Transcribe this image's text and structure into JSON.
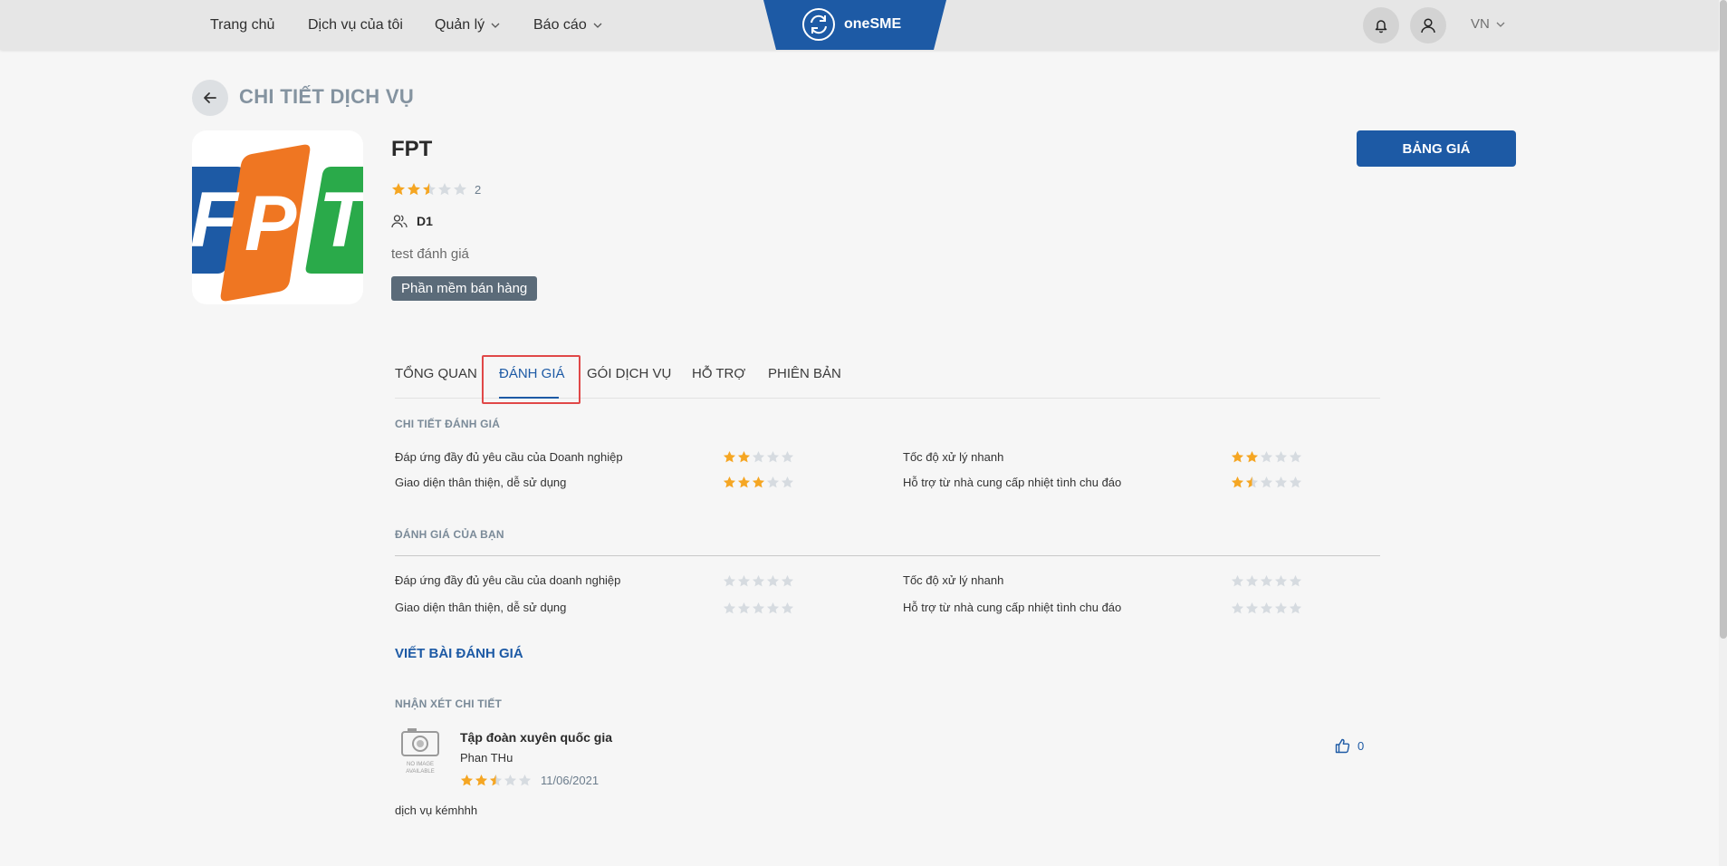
{
  "header": {
    "nav": [
      {
        "label": "Trang chủ",
        "dropdown": false
      },
      {
        "label": "Dịch vụ của tôi",
        "dropdown": false
      },
      {
        "label": "Quản lý",
        "dropdown": true
      },
      {
        "label": "Báo cáo",
        "dropdown": true
      }
    ],
    "brand": "oneSME",
    "brand_color": "#1d5aa5",
    "language": "VN"
  },
  "page": {
    "title": "CHI TIẾT DỊCH VỤ"
  },
  "product": {
    "name": "FPT",
    "logo_letters": [
      "F",
      "P",
      "T"
    ],
    "logo_colors": [
      "#1d5aa5",
      "#ef7622",
      "#2aaa4a"
    ],
    "rating": 2.5,
    "rating_count": "2",
    "owner": "D1",
    "description": "test đánh giá",
    "category": "Phần mềm bán hàng",
    "price_button": "BẢNG GIÁ"
  },
  "tabs": [
    {
      "label": "TỔNG QUAN",
      "active": false
    },
    {
      "label": "ĐÁNH GIÁ",
      "active": true
    },
    {
      "label": "GÓI DỊCH VỤ",
      "active": false
    },
    {
      "label": "HỖ TRỢ",
      "active": false
    },
    {
      "label": "PHIÊN BẢN",
      "active": false
    }
  ],
  "rating_detail": {
    "title": "CHI TIẾT ĐÁNH GIÁ",
    "criteria": [
      {
        "label": "Đáp ứng đầy đủ yêu cầu của Doanh nghiệp",
        "value": 2
      },
      {
        "label": "Tốc độ xử lý nhanh",
        "value": 2
      },
      {
        "label": "Giao diện thân thiện, dễ sử dụng",
        "value": 3
      },
      {
        "label": "Hỗ trợ từ nhà cung cấp nhiệt tình chu đáo",
        "value": 1.5
      }
    ]
  },
  "your_rating": {
    "title": "ĐÁNH GIÁ CỦA BẠN",
    "criteria": [
      {
        "label": "Đáp ứng đầy đủ yêu cầu của doanh nghiệp",
        "value": 0
      },
      {
        "label": "Tốc độ xử lý nhanh",
        "value": 0
      },
      {
        "label": "Giao diện thân thiện, dễ sử dụng",
        "value": 0
      },
      {
        "label": "Hỗ trợ từ nhà cung cấp nhiệt tình chu đáo",
        "value": 0
      }
    ]
  },
  "write_review": "VIẾT BÀI ĐÁNH GIÁ",
  "comments": {
    "title": "NHẬN XÉT CHI TIẾT",
    "items": [
      {
        "company": "Tập đoàn xuyên quốc gia",
        "author": "Phan THu",
        "rating": 2.5,
        "date": "11/06/2021",
        "comment": "dịch vụ kémhhh",
        "likes": "0",
        "avatar_text": [
          "NO IMAGE",
          "AVAILABLE"
        ]
      }
    ]
  },
  "colors": {
    "star_filled": "#f5a623",
    "star_empty": "#d6dbe0",
    "accent": "#1d5aa5",
    "highlight": "#e04848"
  }
}
